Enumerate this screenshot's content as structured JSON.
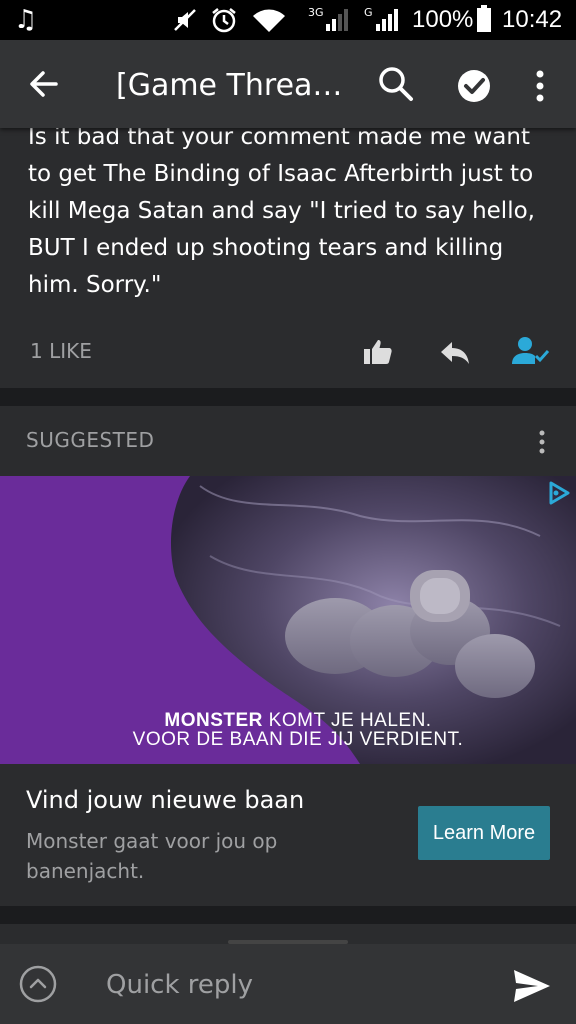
{
  "status_bar": {
    "network_3g": "3G",
    "network_g": "G",
    "battery": "100%",
    "time": "10:42",
    "icons": [
      "music-icon",
      "mute-icon",
      "alarm-icon",
      "wifi-icon",
      "signal-icon",
      "battery-icon"
    ]
  },
  "app_bar": {
    "title": "[Game Thread...",
    "icons": [
      "back-arrow-icon",
      "search-icon",
      "check-circle-icon",
      "more-vert-icon"
    ]
  },
  "comment": {
    "text": "Is it bad that your comment made me want to get The Binding of Isaac Afterbirth just to kill Mega Satan and say \"I tried to say hello, BUT I ended up shooting tears and killing him. Sorry.\"",
    "likes": "1 LIKE",
    "icons": [
      "thumbs-up-icon",
      "reply-icon",
      "person-check-icon"
    ],
    "follow_color": "#2ba9d8"
  },
  "suggested": {
    "label": "SUGGESTED"
  },
  "ad": {
    "brand": "MONSTER",
    "headline_rest": " KOMT JE HALEN.",
    "headline_line2": "VOOR DE BAAN DIE JIJ VERDIENT.",
    "title": "Vind jouw nieuwe baan",
    "description": "Monster gaat voor jou op banenjacht.",
    "cta": "Learn More",
    "background_color": "#6a2c9a",
    "cta_color": "#2a7d90"
  },
  "reply_bar": {
    "placeholder": "Quick reply",
    "icons": [
      "chevron-up-circle-icon",
      "send-icon"
    ]
  }
}
